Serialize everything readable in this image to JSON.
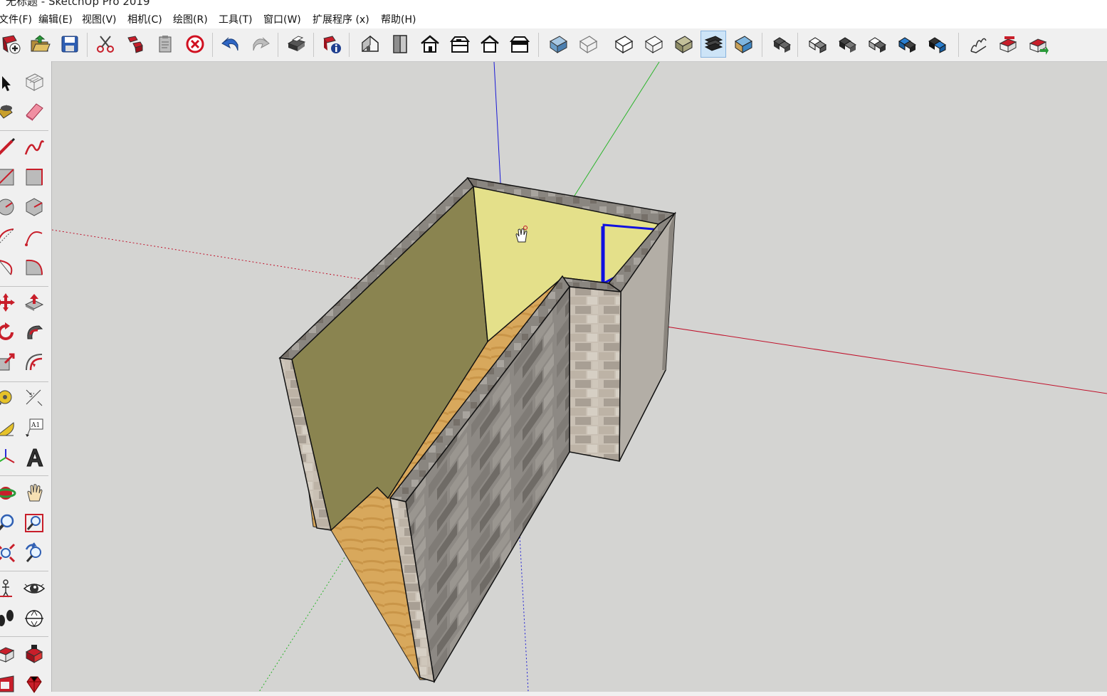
{
  "window": {
    "title": "无标题 - SketchUp Pro 2019"
  },
  "menu": {
    "items": [
      "文件(F)",
      "编辑(E)",
      "视图(V)",
      "相机(C)",
      "绘图(R)",
      "工具(T)",
      "窗口(W)",
      "扩展程序 (x)",
      "帮助(H)"
    ]
  },
  "toolbar": {
    "buttons": [
      "new-icon",
      "open-icon",
      "save-icon",
      "cut-icon",
      "copy-icon",
      "paste-icon",
      "delete-icon",
      "undo-icon",
      "redo-icon",
      "print-icon",
      "model-info-icon",
      "iso-view-icon",
      "top-view-icon",
      "front-view-icon",
      "right-view-icon",
      "back-view-icon",
      "left-view-icon",
      "xray-style-icon",
      "wireframe-style-icon",
      "hidden-line-style-icon",
      "shaded-style-icon",
      "shaded-textures-style-icon",
      "monochrome-style-icon",
      "outer-shell-icon",
      "union-icon",
      "subtract-icon",
      "intersect-icon",
      "trim-icon",
      "split-icon",
      "sandbox-icon",
      "warehouse-icon",
      "extension-warehouse-icon"
    ],
    "active": "shaded-textures-style-icon"
  },
  "left_toolbar": {
    "tools": [
      [
        "select-icon",
        "component-icon"
      ],
      [
        "paint-bucket-icon",
        "eraser-icon"
      ],
      [
        "line-icon",
        "freehand-icon"
      ],
      [
        "rectangle-icon",
        "rotated-rectangle-icon"
      ],
      [
        "circle-icon",
        "polygon-icon"
      ],
      [
        "arc-icon",
        "two-point-arc-icon"
      ],
      [
        "three-point-arc-icon",
        "pie-icon"
      ],
      [
        "move-icon",
        "push-pull-icon"
      ],
      [
        "rotate-icon",
        "follow-me-icon"
      ],
      [
        "scale-icon",
        "offset-icon"
      ],
      [
        "tape-measure-icon",
        "dimension-icon"
      ],
      [
        "protractor-icon",
        "text-icon"
      ],
      [
        "axes-icon",
        "3d-text-icon"
      ],
      [
        "orbit-icon",
        "pan-icon"
      ],
      [
        "zoom-icon",
        "zoom-window-icon"
      ],
      [
        "zoom-extents-icon",
        "previous-view-icon"
      ],
      [
        "position-camera-icon",
        "look-around-icon"
      ],
      [
        "walk-icon",
        "section-plane-icon"
      ],
      [
        "warehouse-icon-2",
        "extension-manager-icon"
      ],
      [
        "layout-icon",
        "ruby-icon"
      ]
    ]
  },
  "toolbar_labels": {
    "text_tool": "A1"
  },
  "colors": {
    "sky": "#d4d4d2",
    "axis_red": "#c0102a",
    "axis_green": "#2bb42b",
    "axis_blue": "#1a1ad6",
    "wall_yellow": "#e4e08a",
    "wall_olive": "#8a8450",
    "floor": "#d8a85c",
    "stone": "#8f8b85",
    "selection": "#1010e0"
  }
}
